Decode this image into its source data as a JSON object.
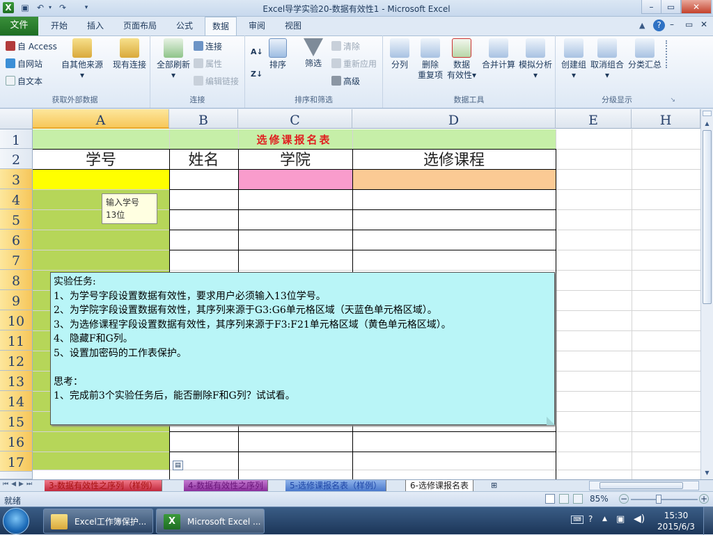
{
  "window": {
    "title": "Excel导学实验20-数据有效性1 - Microsoft Excel",
    "controls": {
      "minimize": "–",
      "restore": "▭",
      "close": "✕"
    }
  },
  "ribbon_tabs": [
    "文件",
    "开始",
    "插入",
    "页面布局",
    "公式",
    "数据",
    "审阅",
    "视图"
  ],
  "active_tab": "数据",
  "groups": {
    "external": {
      "label": "获取外部数据",
      "access": "自 Access",
      "web": "自网站",
      "text": "自文本",
      "other": "自其他来源",
      "existing": "现有连接"
    },
    "connections": {
      "label": "连接",
      "refresh": "全部刷新",
      "conn": "连接",
      "props": "属性",
      "edit": "编辑链接"
    },
    "sort": {
      "label": "排序和筛选",
      "sort": "排序",
      "filter": "筛选",
      "clear": "清除",
      "reapply": "重新应用",
      "advanced": "高级"
    },
    "tools": {
      "label": "数据工具",
      "split": "分列",
      "remove_dup_1": "删除",
      "remove_dup_2": "重复项",
      "validation_1": "数据",
      "validation_2": "有效性",
      "consolidate": "合并计算",
      "whatif": "模拟分析"
    },
    "outline": {
      "label": "分级显示",
      "group": "创建组",
      "ungroup": "取消组合",
      "subtotal": "分类汇总"
    }
  },
  "columns": [
    "A",
    "B",
    "C",
    "D",
    "E",
    "H"
  ],
  "rows": [
    "1",
    "2",
    "3",
    "4",
    "5",
    "6",
    "7",
    "8",
    "9",
    "10",
    "11",
    "12",
    "13",
    "14",
    "15",
    "16",
    "17"
  ],
  "sheet": {
    "title": "选修课报名表",
    "headers": [
      "学号",
      "姓名",
      "学院",
      "选修课程"
    ]
  },
  "tooltip": {
    "line1": "输入学号",
    "line2": "13位"
  },
  "comment": {
    "lines": [
      "实验任务:",
      "1、为学号字段设置数据有效性，要求用户必须输入13位学号。",
      "2、为学院字段设置数据有效性，其序列来源于G3:G6单元格区域（天蓝色单元格区域）。",
      "3、为选修课程字段设置数据有效性，其序列来源于F3:F21单元格区域（黄色单元格区域）。",
      "4、隐藏F和G列。",
      "5、设置加密码的工作表保护。",
      "",
      "思考：",
      "1、完成前3个实验任务后，能否删除F和G列？试试看。"
    ]
  },
  "sheet_tabs": [
    "3-数据有效性之序列（样例）",
    "4-数据有效性之序列",
    "5-选修课报名表（样例）",
    "6-选修课报名表"
  ],
  "status": {
    "ready": "就绪",
    "zoom": "85%"
  },
  "taskbar": {
    "items": [
      "Excel工作簿保护...",
      "Microsoft Excel ..."
    ],
    "time": "15:30",
    "date": "2015/6/3"
  },
  "colors": {
    "title_band": "#c6efa8",
    "title_text": "#e02020",
    "col_a": "#b6d659",
    "a3": "#ffff00",
    "c3": "#f99ccc",
    "d3": "#fbca94",
    "comment_bg": "#b9f5f7"
  }
}
